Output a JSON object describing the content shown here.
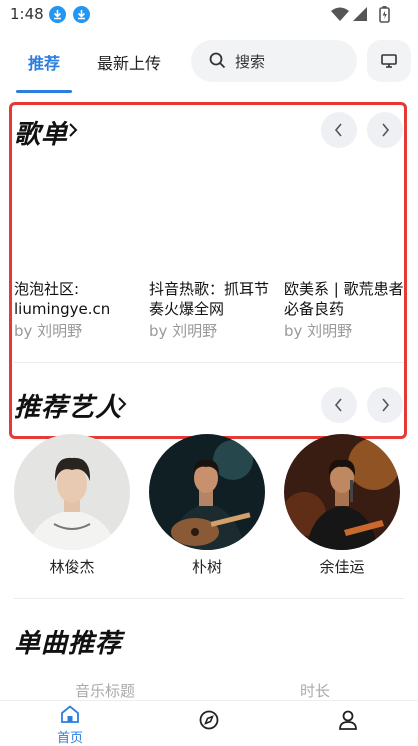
{
  "status_bar": {
    "time": "1:48",
    "icons": [
      "download-icon",
      "download-icon",
      "wifi-icon",
      "signal-icon",
      "battery-icon"
    ]
  },
  "tabs": [
    {
      "label": "推荐",
      "active": true
    },
    {
      "label": "最新上传",
      "active": false
    }
  ],
  "search": {
    "placeholder": "搜索"
  },
  "playlists_section": {
    "title": "歌单",
    "items": [
      {
        "title": "泡泡社区: liumingye.cn",
        "author": "by 刘明野"
      },
      {
        "title": "抖音热歌：抓耳节奏火爆全网",
        "author": "by 刘明野"
      },
      {
        "title": "欧美系 | 歌荒患者必备良药",
        "author": "by 刘明野"
      }
    ]
  },
  "artists_section": {
    "title": "推荐艺人",
    "items": [
      {
        "name": "林俊杰"
      },
      {
        "name": "朴树"
      },
      {
        "name": "余佳运"
      }
    ]
  },
  "songs_section": {
    "title": "单曲推荐",
    "columns": [
      "音乐标题",
      "时长"
    ]
  },
  "bottom_nav": {
    "items": [
      {
        "label": "首页",
        "icon": "home-icon",
        "active": true
      },
      {
        "label": "",
        "icon": "compass-icon",
        "active": false
      },
      {
        "label": "",
        "icon": "user-icon",
        "active": false
      }
    ]
  },
  "colors": {
    "accent": "#2b7de0",
    "highlight": "#e53935"
  }
}
